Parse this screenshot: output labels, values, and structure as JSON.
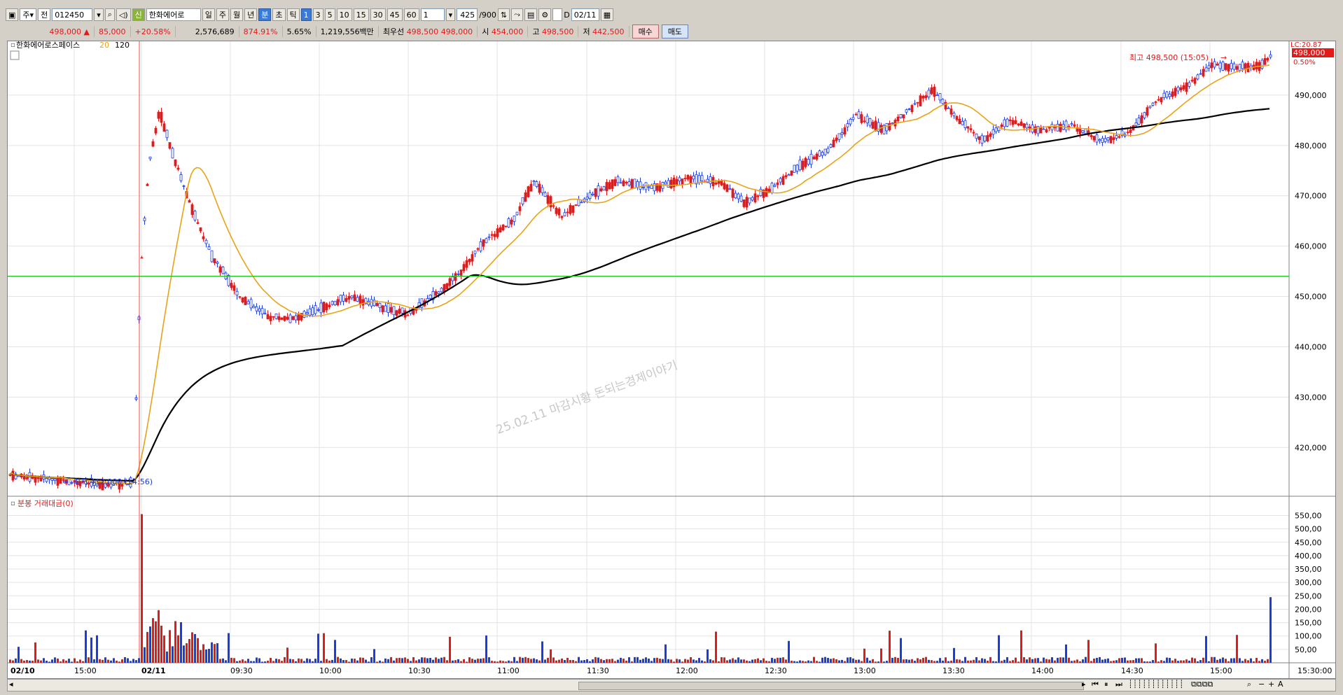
{
  "toolbar": {
    "market_type": "주",
    "market_scope": "전",
    "stock_code": "012450",
    "badge_new": "신",
    "stock_name": "한화에어로",
    "period_tabs": [
      "일",
      "주",
      "월",
      "년"
    ],
    "active_tabs": [
      "분",
      "초",
      "틱"
    ],
    "minute_intervals": [
      "1",
      "3",
      "5",
      "10",
      "15",
      "30",
      "45",
      "60"
    ],
    "multiplier": "1",
    "count": "425",
    "count_max": "/900",
    "date": "02/11",
    "checkbox_label": "D"
  },
  "quote": {
    "price": "498,000",
    "change": "85,000",
    "change_pct": "+20.58%",
    "volume": "2,576,689",
    "volume_pct": "874.91%",
    "turnover_rate": "5.65%",
    "amount": "1,219,556백만",
    "best_label": "최우선",
    "best_ask": "498,500",
    "best_bid": "498,000",
    "open_label": "시",
    "open": "454,000",
    "high_label": "고",
    "high": "498,500",
    "low_label": "저",
    "low": "442,500",
    "buy_button": "매수",
    "sell_button": "매도"
  },
  "chart": {
    "title": "한화에어로스페이스",
    "ma_short": "20",
    "ma_long": "120",
    "lc_label": "LC:20.87",
    "current_price_tag": "498,000",
    "current_pct_tag": "0.50%",
    "high_annotation": "최고 498,500 (15:05)",
    "low_annotation": "최저 412,000 (14:56)",
    "watermark": "25.02.11 마감시황 돈되는경제이야기",
    "volume_panel_title": "분봉 거래대금(0)"
  },
  "chart_data": {
    "type": "candlestick",
    "price_axis_ticks": [
      "490,000",
      "480,000",
      "470,000",
      "460,000",
      "450,000",
      "440,000",
      "430,000",
      "420,000"
    ],
    "price_ylim": [
      411000,
      500000
    ],
    "volume_axis_ticks": [
      "550,00",
      "500,00",
      "450,00",
      "400,00",
      "350,00",
      "300,00",
      "250,00",
      "200,00",
      "150,00",
      "100,00",
      "50,00"
    ],
    "volume_ylim": [
      0,
      580
    ],
    "time_axis_labels": [
      "02/10",
      "15:00",
      "02/11",
      "09:30",
      "10:00",
      "10:30",
      "11:00",
      "11:30",
      "12:00",
      "12:30",
      "13:00",
      "13:30",
      "14:00",
      "14:30",
      "15:00",
      "15:30:00"
    ],
    "reference_line_price": 454000,
    "series": [
      {
        "name": "20",
        "color": "#e8a317"
      },
      {
        "name": "120",
        "color": "#000000"
      }
    ]
  },
  "colors": {
    "up": "#e21a1a",
    "down": "#1a3ce2",
    "ma_short": "#e8a317",
    "ma_long": "#000000",
    "ref_line": "#22cc22"
  }
}
